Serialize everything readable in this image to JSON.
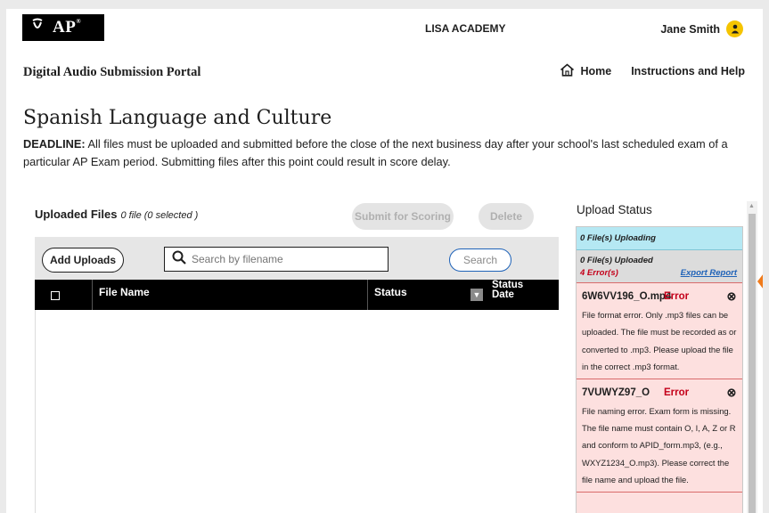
{
  "header": {
    "logo_text": "AP",
    "school": "LISA ACADEMY",
    "user_name": "Jane Smith",
    "portal_title": "Digital Audio Submission Portal",
    "nav": {
      "home": "Home",
      "help": "Instructions and Help"
    }
  },
  "main": {
    "course_title": "Spanish Language and Culture",
    "deadline_label": "DEADLINE:",
    "deadline_text": " All files must be uploaded and submitted before the close of the next business day after your school's last scheduled exam of a particular AP Exam period. Submitting files after this point could result in score delay."
  },
  "uploaded_files": {
    "title": "Uploaded Files",
    "count_text": "0 file (0 selected )",
    "submit_label": "Submit for Scoring",
    "delete_label": "Delete",
    "add_uploads_label": "Add Uploads",
    "search_placeholder": "Search by filename",
    "search_button": "Search",
    "columns": {
      "file_name": "File Name",
      "status": "Status",
      "status_date_1": "Status",
      "status_date_2": "Date"
    }
  },
  "upload_status": {
    "title": "Upload Status",
    "uploading": "0 File(s) Uploading",
    "uploaded": "0 File(s) Uploaded",
    "errors": "4 Error(s)",
    "export_report": "Export Report",
    "items": [
      {
        "filename": "6W6VV196_O.mp4",
        "status": "Error",
        "message": "File format error. Only .mp3 files can be uploaded. The file must be recorded as or converted to .mp3. Please upload the file in the correct .mp3 format."
      },
      {
        "filename": "7VUWYZ97_O",
        "status": "Error",
        "message": "File naming error. Exam form is missing. The file name must contain O, I, A, Z or R and conform to APID_form.mp3, (e.g., WXYZ1234_O.mp3). Please correct the file name and upload the file."
      }
    ]
  },
  "colors": {
    "error_red": "#c4001a",
    "link_blue": "#1e62b8",
    "uploading_bg": "#b5e8f3",
    "error_bg": "#fde0df",
    "avatar_yellow": "#f5c400",
    "accent_orange": "#f07a1a"
  }
}
